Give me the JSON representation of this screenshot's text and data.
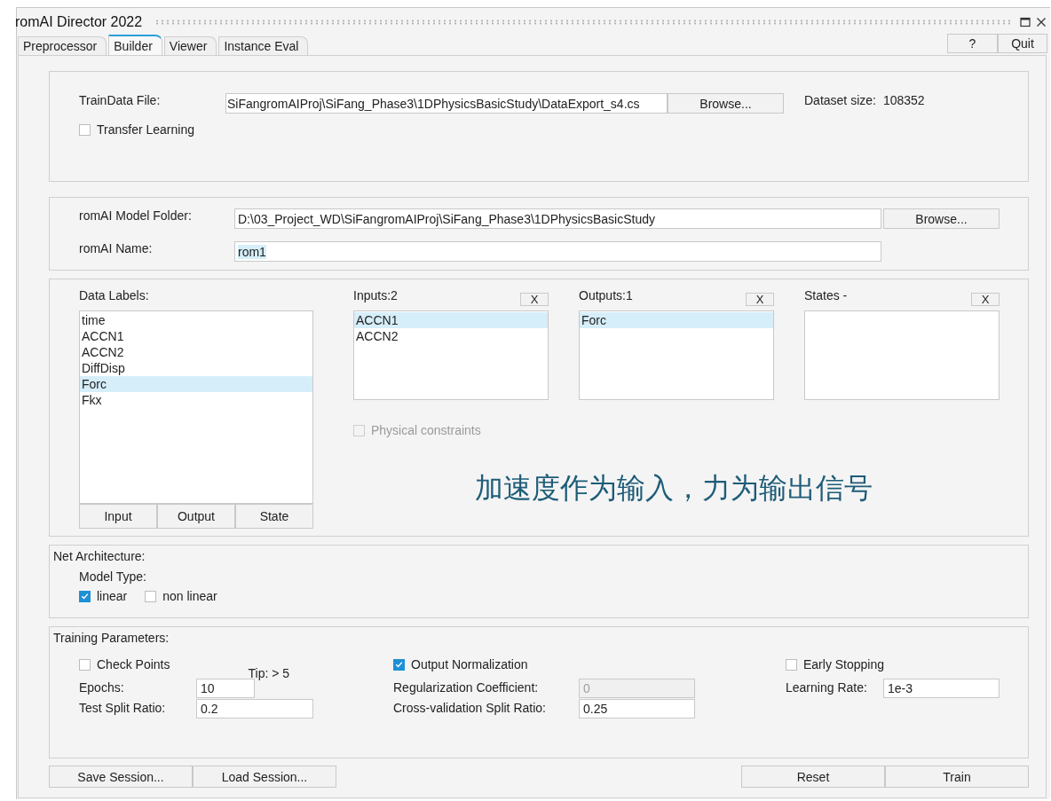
{
  "window": {
    "title": "romAI Director 2022"
  },
  "tabs": [
    {
      "label": "Preprocessor",
      "selected": false
    },
    {
      "label": "Builder",
      "selected": true
    },
    {
      "label": "Viewer",
      "selected": false
    },
    {
      "label": "Instance Eval",
      "selected": false
    }
  ],
  "toolbar_buttons": [
    "?",
    "Quit"
  ],
  "train_data": {
    "label": "TrainData File:",
    "value": "SiFangromAIProj\\SiFang_Phase3\\1DPhysicsBasicStudy\\DataExport_s4.cs",
    "browse": "Browse...",
    "dataset_size_label": "Dataset size:",
    "dataset_size": "108352",
    "transfer_learning": {
      "label": "Transfer Learning",
      "checked": false
    }
  },
  "model_folder": {
    "label": "romAI Model Folder:",
    "value": "D:\\03_Project_WD\\SiFangromAIProj\\SiFang_Phase3\\1DPhysicsBasicStudy",
    "browse": "Browse..."
  },
  "model_name": {
    "label": "romAI Name:",
    "value": "rom1",
    "selected": true
  },
  "data_labels": {
    "title": "Data Labels:",
    "items": [
      {
        "label": "time",
        "selected": false
      },
      {
        "label": "ACCN1",
        "selected": false
      },
      {
        "label": "ACCN2",
        "selected": false
      },
      {
        "label": "DiffDisp",
        "selected": false
      },
      {
        "label": "Forc",
        "selected": true
      },
      {
        "label": "Fkx",
        "selected": false
      }
    ],
    "buttons": [
      "Input",
      "Output",
      "State"
    ]
  },
  "signal_lists": [
    {
      "title": "Inputs:2",
      "clear": "X",
      "items": [
        {
          "label": "ACCN1",
          "selected": true
        },
        {
          "label": "ACCN2",
          "selected": false
        }
      ]
    },
    {
      "title": "Outputs:1",
      "clear": "X",
      "items": [
        {
          "label": "Forc",
          "selected": true
        }
      ]
    },
    {
      "title": "States -",
      "clear": "X"
    }
  ],
  "physical_constraints": {
    "label": "Physical constraints",
    "checked": false,
    "disabled": true
  },
  "annotation": "加速度作为输入，力为输出信号",
  "net_architecture": {
    "title": "Net Architecture:",
    "model_type_label": "Model Type:",
    "options": [
      {
        "label": "linear",
        "checked": true
      },
      {
        "label": "non linear",
        "checked": false
      }
    ]
  },
  "training": {
    "title": "Training Parameters:",
    "options": [
      {
        "label": "Check Points",
        "checked": false
      },
      {
        "label": "Output Normalization",
        "checked": true
      },
      {
        "label": "Early Stopping",
        "checked": false
      }
    ],
    "tip": "Tip: > 5",
    "fields": [
      {
        "label": "Epochs:",
        "value": "10",
        "disabled": false
      },
      {
        "label": "Regularization Coefficient:",
        "value": "0",
        "disabled": true
      },
      {
        "label": "Learning Rate:",
        "value": "1e-3",
        "disabled": false
      },
      {
        "label": "Test Split Ratio:",
        "value": "0.2",
        "disabled": false
      },
      {
        "label": "Cross-validation Split Ratio:",
        "value": "0.25",
        "disabled": false
      }
    ]
  },
  "footer_left": [
    "Save Session...",
    "Load Session..."
  ],
  "footer_right": [
    "Reset",
    "Train"
  ]
}
